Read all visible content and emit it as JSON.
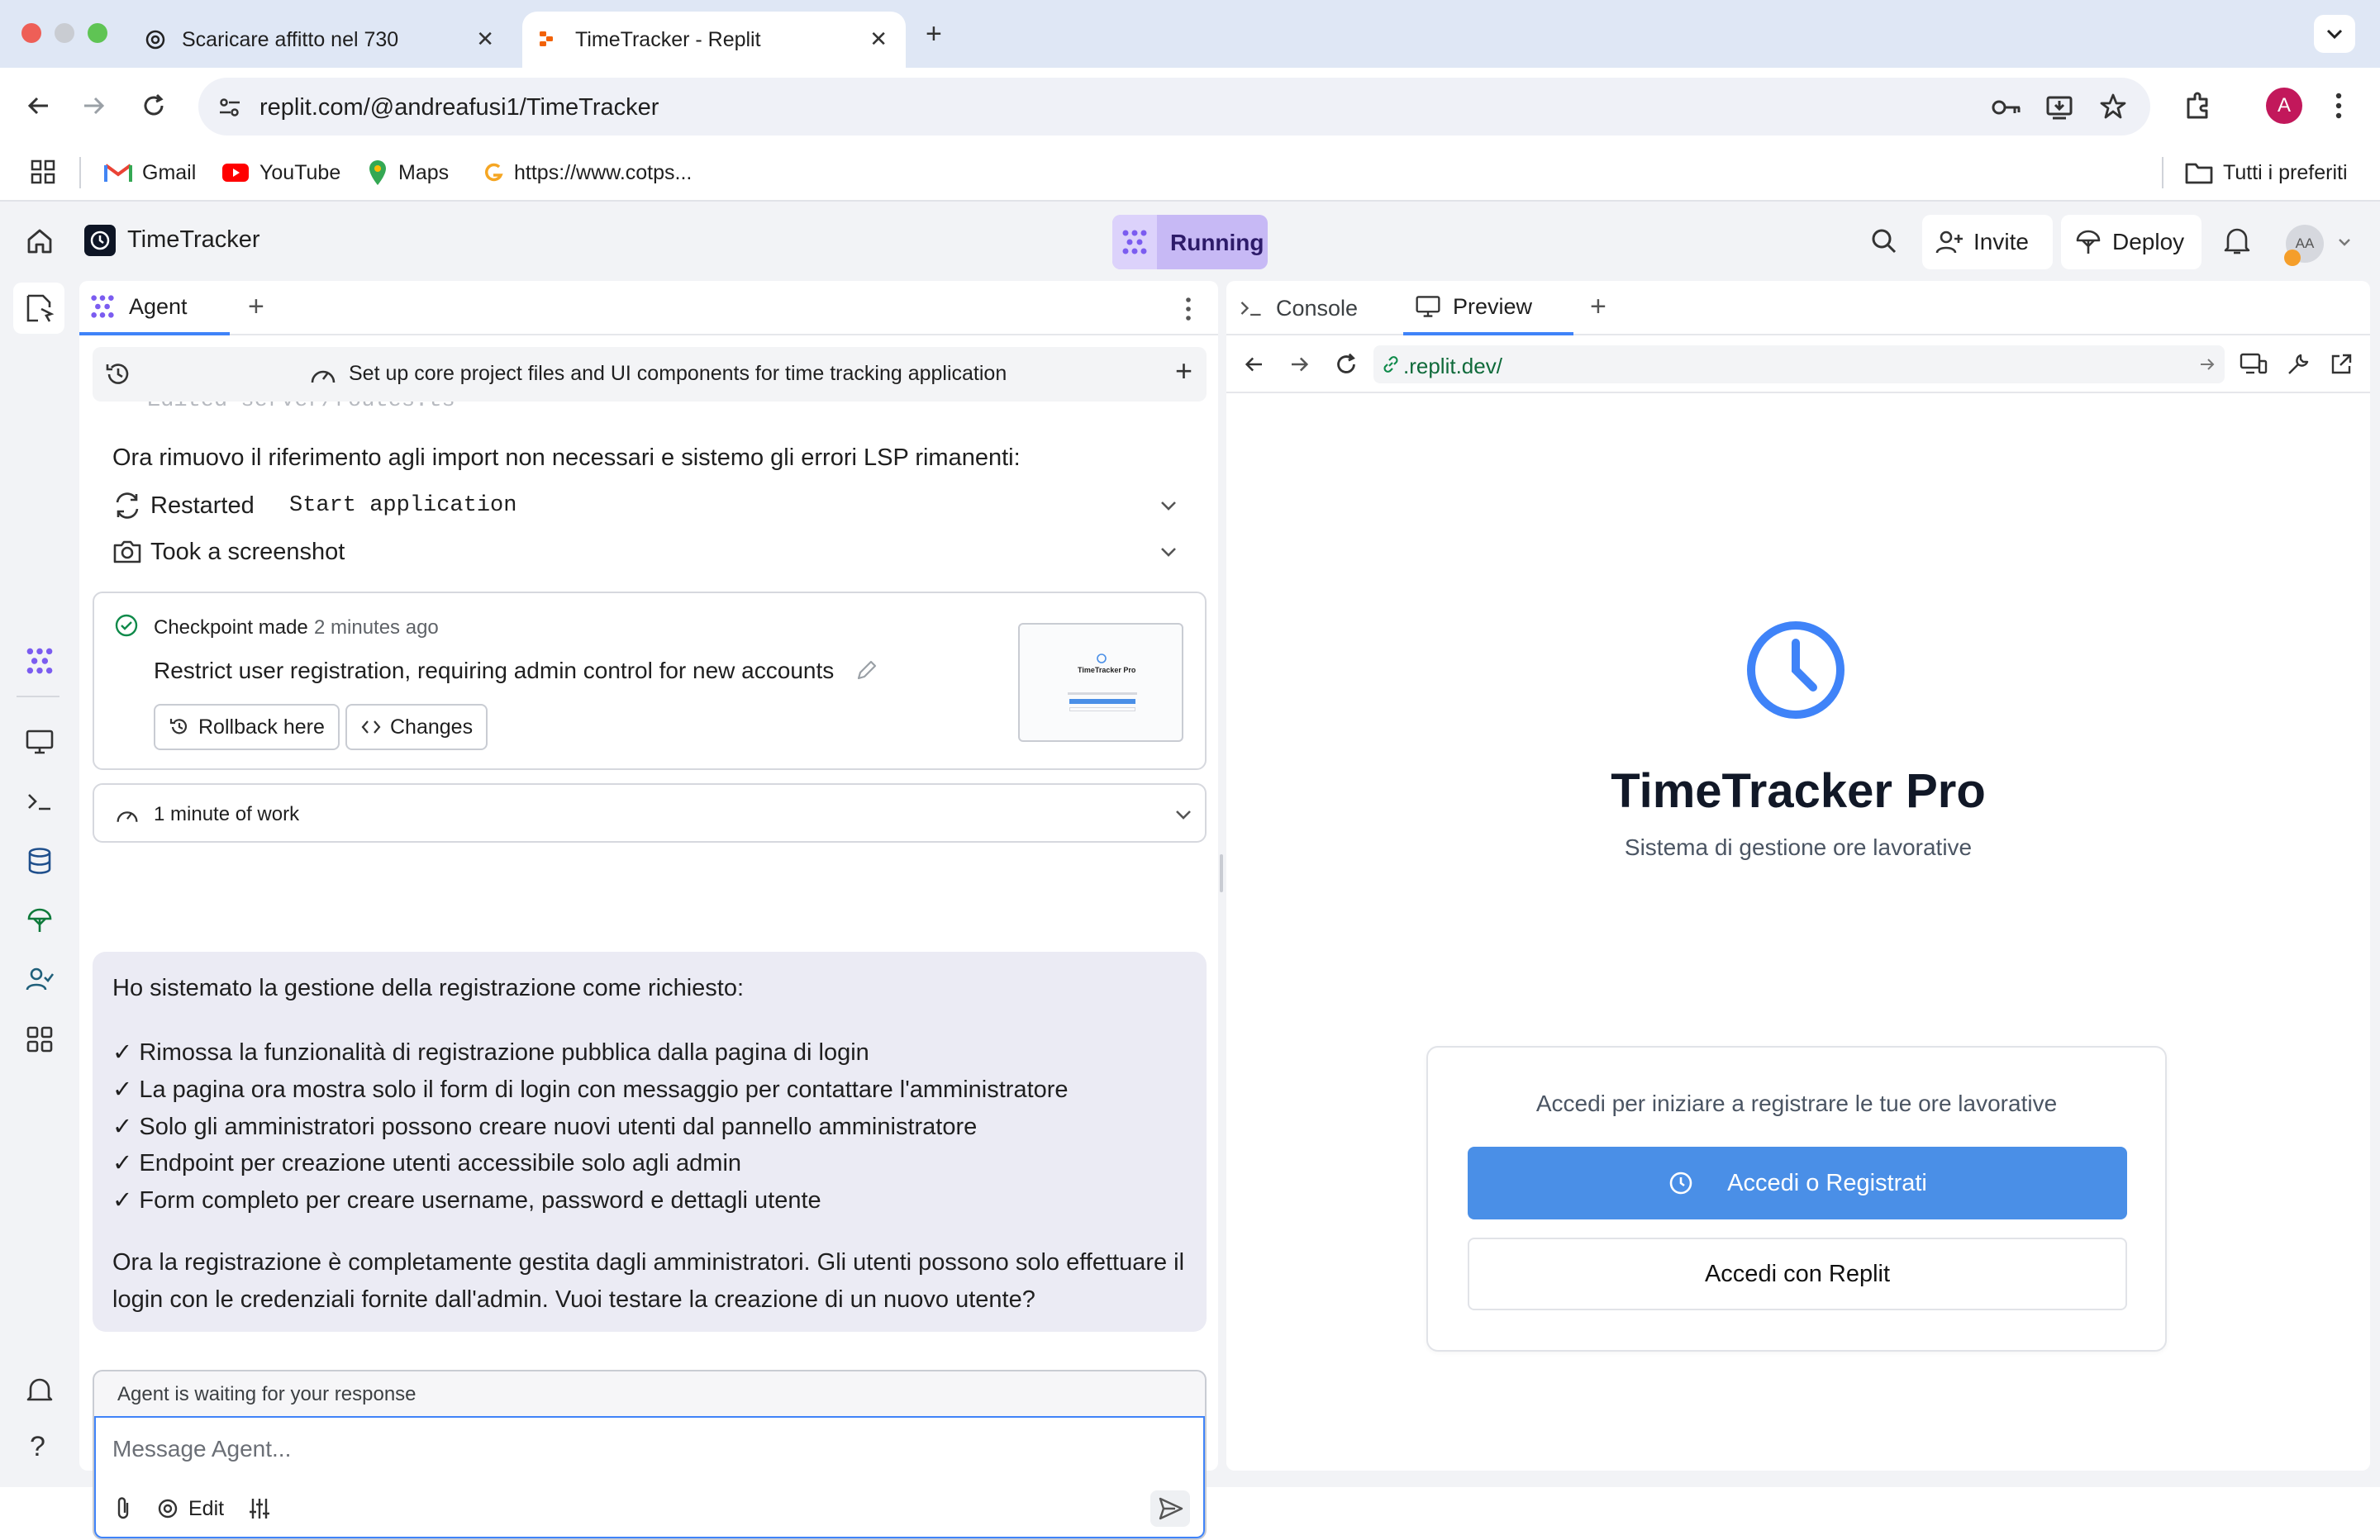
{
  "browser": {
    "tabs": [
      {
        "title": "Scaricare affitto nel 730",
        "active": false
      },
      {
        "title": "TimeTracker - Replit",
        "active": true
      }
    ],
    "url": "replit.com/@andreafusi1/TimeTracker",
    "profile_initial": "A",
    "bookmarks": [
      {
        "label": "Gmail"
      },
      {
        "label": "YouTube"
      },
      {
        "label": "Maps"
      },
      {
        "label": "https://www.cotps..."
      }
    ],
    "all_bookmarks": "Tutti i preferiti"
  },
  "replit": {
    "project_name": "TimeTracker",
    "run_status": "Running",
    "invite_label": "Invite",
    "deploy_label": "Deploy",
    "avatar_initials": "AA"
  },
  "agent": {
    "tab_label": "Agent",
    "task_title": "Set up core project files and UI components for time tracking application",
    "cut_off_line": "Edited server/routes.ts",
    "intro_line": "Ora rimuovo il riferimento agli import non necessari e sistemo gli errori LSP rimanenti:",
    "step_restart_prefix": "Restarted",
    "step_restart_code": "Start application",
    "step_screenshot": "Took a screenshot",
    "checkpoint_label": "Checkpoint made",
    "checkpoint_time": "2 minutes ago",
    "checkpoint_desc": "Restrict user registration, requiring admin control for new accounts",
    "rollback_label": "Rollback here",
    "changes_label": "Changes",
    "work_duration": "1 minute of work",
    "message": {
      "intro": "Ho sistemato la gestione della registrazione come richiesto:",
      "bullets": [
        "✓ Rimossa la funzionalità di registrazione pubblica dalla pagina di login",
        "✓ La pagina ora mostra solo il form di login con messaggio per contattare l'amministratore",
        "✓ Solo gli amministratori possono creare nuovi utenti dal pannello amministratore",
        "✓ Endpoint per creazione utenti accessibile solo agli admin",
        "✓ Form completo per creare username, password e dettagli utente"
      ],
      "closing_1": "Ora la registrazione è completamente gestita dagli amministratori. Gli utenti possono solo effettuare il",
      "closing_2": "login con le credenziali fornite dall'admin. Vuoi testare la creazione di un nuovo utente?"
    },
    "waiting_status": "Agent is waiting for your response",
    "input_placeholder": "Message Agent...",
    "edit_label": "Edit"
  },
  "preview": {
    "console_tab": "Console",
    "preview_tab": "Preview",
    "url": ".replit.dev/",
    "app_title": "TimeTracker Pro",
    "app_subtitle": "Sistema di gestione ore lavorative",
    "card_prompt": "Accedi per iniziare a registrare le tue ore lavorative",
    "primary_button": "Accedi o Registrati",
    "secondary_button": "Accedi con Replit",
    "thumb_title": "TimeTracker Pro"
  },
  "colors": {
    "accent_blue": "#4a8fe7",
    "running_bg": "#c7b9f5",
    "running_text": "#3b1f8c",
    "message_bg": "#ebebf4",
    "tabstrip_bg": "#dfe7f5"
  }
}
